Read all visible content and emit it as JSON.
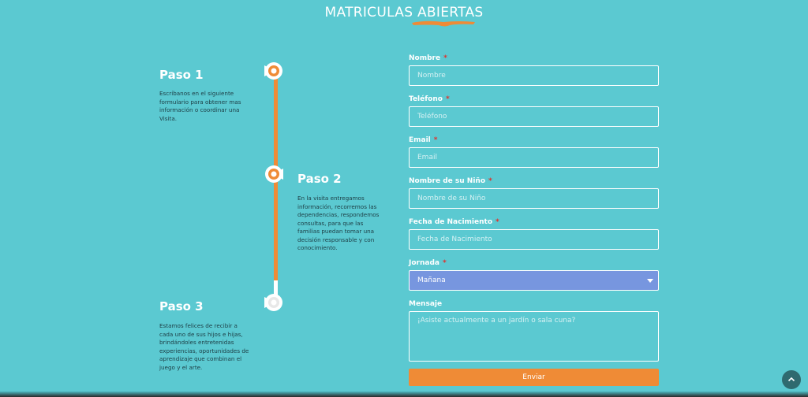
{
  "header": {
    "title": "MATRICULAS ABIERTAS"
  },
  "steps": [
    {
      "title": "Paso 1",
      "description": "Escríbanos en el siguiente formulario para obtener mas información o coordinar una Visita."
    },
    {
      "title": "Paso 2",
      "description": "En la visita entregamos información, recorremos las dependencias, respondemos consultas, para que las familias puedan tomar una decisión responsable y con conocimiento."
    },
    {
      "title": "Paso 3",
      "description": "Estamos felices de recibir a cada uno de sus hijos e hijas, brindándoles entretenidas experiencias, oportunidades de aprendizaje que combinan el juego y el arte."
    }
  ],
  "form": {
    "required_mark": "*",
    "name": {
      "label": "Nombre",
      "placeholder": "Nombre"
    },
    "phone": {
      "label": "Teléfono",
      "placeholder": "Teléfono"
    },
    "email": {
      "label": "Email",
      "placeholder": "Email"
    },
    "child_name": {
      "label": "Nombre de su Niño",
      "placeholder": "Nombre de su Niño"
    },
    "birth_date": {
      "label": "Fecha de Nacimiento",
      "placeholder": "Fecha de Nacimiento"
    },
    "schedule": {
      "label": "Jornada",
      "value": "Mañana"
    },
    "message": {
      "label": "Mensaje",
      "placeholder": "¡Asiste actualmente a un jardín o sala cuna?"
    },
    "submit_label": "Enviar"
  },
  "colors": {
    "background": "#5bc9d1",
    "accent_orange": "#ef8b36",
    "select_bg": "#7796df",
    "text_dark": "#1d3d44"
  },
  "icons": {
    "scroll_top": "chevron-up-icon",
    "timeline_node": "circle-node-icon"
  }
}
